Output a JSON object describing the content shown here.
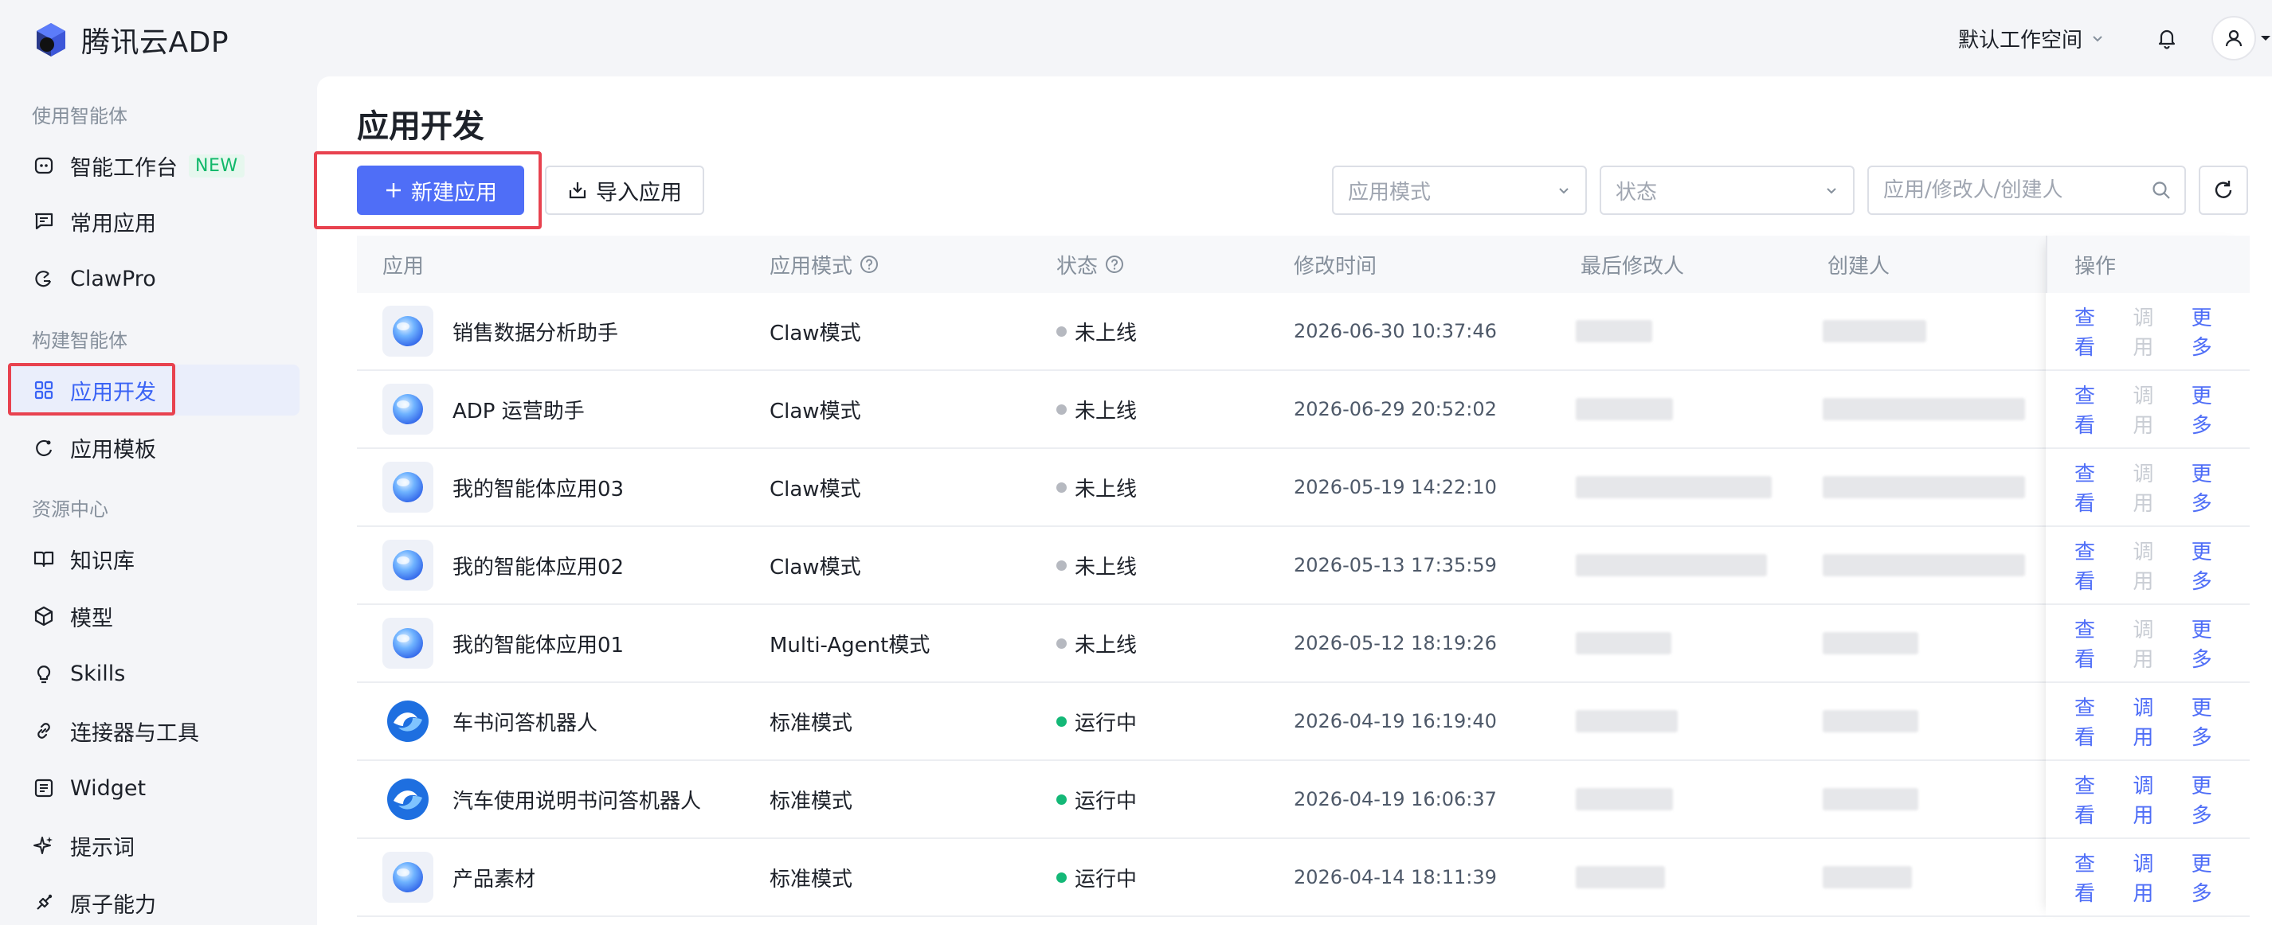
{
  "brand": {
    "name": "腾讯云ADP"
  },
  "header": {
    "workspace": "默认工作空间"
  },
  "sidebar": {
    "groups": [
      "使用智能体",
      "构建智能体",
      "资源中心"
    ],
    "items": [
      {
        "label": "智能工作台",
        "badge": "NEW",
        "icon": "robot-icon"
      },
      {
        "label": "常用应用",
        "icon": "message-square-icon"
      },
      {
        "label": "ClawPro",
        "icon": "claw-icon"
      },
      {
        "label": "应用开发",
        "icon": "grid-icon",
        "active": true
      },
      {
        "label": "应用模板",
        "icon": "template-icon"
      },
      {
        "label": "知识库",
        "icon": "book-icon"
      },
      {
        "label": "模型",
        "icon": "cube-icon"
      },
      {
        "label": "Skills",
        "icon": "lightbulb-icon"
      },
      {
        "label": "连接器与工具",
        "icon": "link-icon"
      },
      {
        "label": "Widget",
        "icon": "widget-icon"
      },
      {
        "label": "提示词",
        "icon": "sparkle-icon"
      },
      {
        "label": "原子能力",
        "icon": "atom-icon"
      }
    ]
  },
  "main": {
    "title": "应用开发",
    "new_button": "新建应用",
    "import_button": "导入应用",
    "filter_mode_placeholder": "应用模式",
    "filter_status_placeholder": "状态",
    "search_placeholder": "应用/修改人/创建人"
  },
  "table": {
    "columns": [
      "应用",
      "应用模式",
      "状态",
      "修改时间",
      "最后修改人",
      "创建人",
      "操作"
    ],
    "ops": {
      "view": "查看",
      "debug": "调用",
      "more": "更多"
    },
    "rows": [
      {
        "name": "销售数据分析助手",
        "mode": "Claw模式",
        "status": "未上线",
        "time": "2026-06-30 10:37:46",
        "online": false,
        "icon": "sphere"
      },
      {
        "name": "ADP 运营助手",
        "mode": "Claw模式",
        "status": "未上线",
        "time": "2026-06-29 20:52:02",
        "online": false,
        "icon": "sphere"
      },
      {
        "name": "我的智能体应用03",
        "mode": "Claw模式",
        "status": "未上线",
        "time": "2026-05-19 14:22:10",
        "online": false,
        "icon": "sphere"
      },
      {
        "name": "我的智能体应用02",
        "mode": "Claw模式",
        "status": "未上线",
        "time": "2026-05-13 17:35:59",
        "online": false,
        "icon": "sphere"
      },
      {
        "name": "我的智能体应用01",
        "mode": "Multi-Agent模式",
        "status": "未上线",
        "time": "2026-05-12 18:19:26",
        "online": false,
        "icon": "sphere"
      },
      {
        "name": "车书问答机器人",
        "mode": "标准模式",
        "status": "运行中",
        "time": "2026-04-19 16:19:40",
        "online": true,
        "icon": "wave"
      },
      {
        "name": "汽车使用说明书问答机器人",
        "mode": "标准模式",
        "status": "运行中",
        "time": "2026-04-19 16:06:37",
        "online": true,
        "icon": "wave"
      },
      {
        "name": "产品素材",
        "mode": "标准模式",
        "status": "运行中",
        "time": "2026-04-14 18:11:39",
        "online": true,
        "icon": "sphere"
      }
    ]
  },
  "colors": {
    "primary": "#4f6ef7",
    "highlight": "#e8424f",
    "online": "#14b877",
    "offline": "#b6b9c0"
  }
}
